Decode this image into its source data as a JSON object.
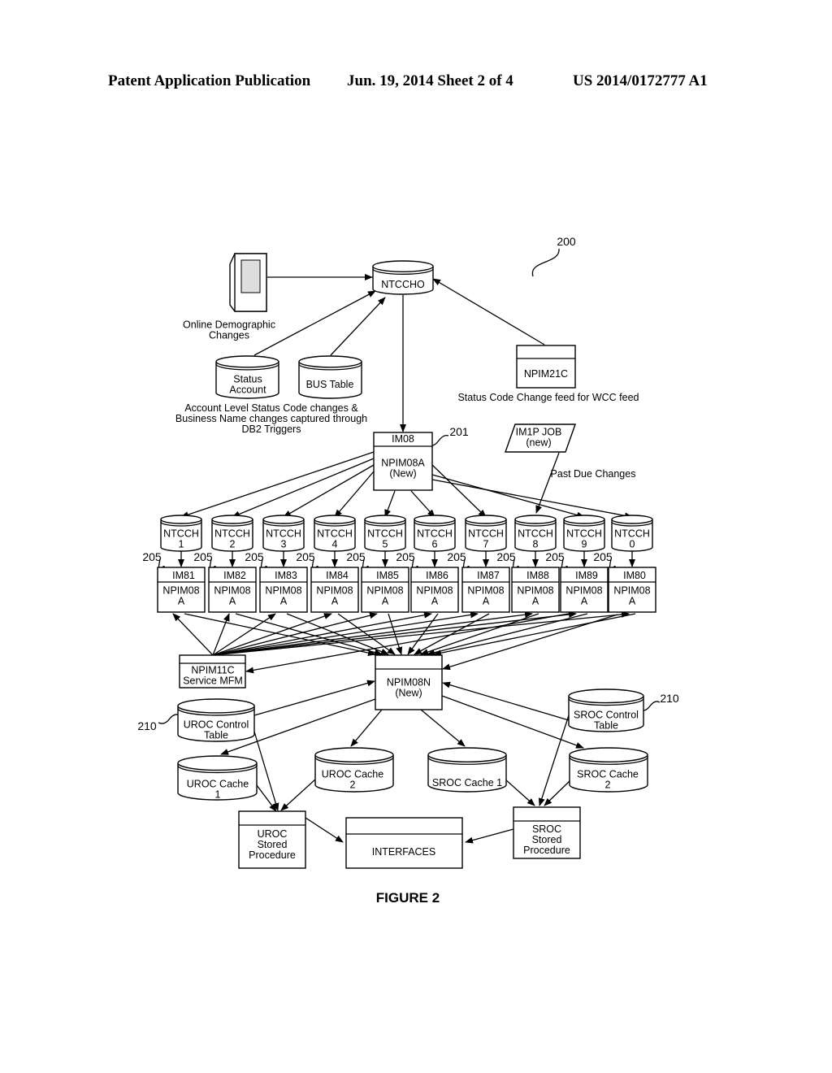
{
  "header": {
    "left": "Patent Application Publication",
    "center": "Jun. 19, 2014  Sheet 2 of 4",
    "right": "US 2014/0172777 A1"
  },
  "figure": {
    "caption": "FIGURE 2",
    "ref_main": "200",
    "ref_npim08a": "201",
    "ref_im": "205",
    "ref_control": "210"
  },
  "nodes": {
    "terminal_label": [
      "Online Demographic",
      "Changes"
    ],
    "ntccho": "NTCCHO",
    "status_account": [
      "Status",
      "Account"
    ],
    "bus_table": [
      "BUS Table"
    ],
    "db2_note": [
      "Account Level Status Code changes &",
      "Business Name changes captured through",
      "DB2 Triggers"
    ],
    "npim21c": "NPIM21C",
    "npim21c_note": "Status Code Change feed for WCC feed",
    "im08": "IM08",
    "npim08a": [
      "NPIM08A",
      "(New)"
    ],
    "im1p_job": [
      "IM1P JOB",
      "(new)"
    ],
    "past_due": "Past Due Changes",
    "npim11c": [
      "NPIM11C",
      "Service MFM"
    ],
    "npim08n": [
      "NPIM08N",
      "(New)"
    ],
    "uroc_control": [
      "UROC Control",
      "Table"
    ],
    "sroc_control": [
      "SROC Control",
      "Table"
    ],
    "uroc_cache1": [
      "UROC  Cache",
      "1"
    ],
    "uroc_cache2": [
      "UROC  Cache",
      "2"
    ],
    "sroc_cache1": [
      "SROC Cache 1"
    ],
    "sroc_cache2": [
      "SROC  Cache",
      "2"
    ],
    "uroc_sp": [
      "UROC",
      "Stored",
      "Procedure"
    ],
    "interfaces": "INTERFACES",
    "sroc_sp": [
      "SROC",
      "Stored",
      "Procedure"
    ]
  },
  "partitions": [
    {
      "db": [
        "NTCCH",
        "1"
      ],
      "im": "IM81",
      "proc": [
        "NPIM08",
        "A"
      ]
    },
    {
      "db": [
        "NTCCH",
        "2"
      ],
      "im": "IM82",
      "proc": [
        "NPIM08",
        "A"
      ]
    },
    {
      "db": [
        "NTCCH",
        "3"
      ],
      "im": "IM83",
      "proc": [
        "NPIM08",
        "A"
      ]
    },
    {
      "db": [
        "NTCCH",
        "4"
      ],
      "im": "IM84",
      "proc": [
        "NPIM08",
        "A"
      ]
    },
    {
      "db": [
        "NTCCH",
        "5"
      ],
      "im": "IM85",
      "proc": [
        "NPIM08",
        "A"
      ]
    },
    {
      "db": [
        "NTCCH",
        "6"
      ],
      "im": "IM86",
      "proc": [
        "NPIM08",
        "A"
      ]
    },
    {
      "db": [
        "NTCCH",
        "7"
      ],
      "im": "IM87",
      "proc": [
        "NPIM08",
        "A"
      ]
    },
    {
      "db": [
        "NTCCH",
        "8"
      ],
      "im": "IM88",
      "proc": [
        "NPIM08",
        "A"
      ]
    },
    {
      "db": [
        "NTCCH",
        "9"
      ],
      "im": "IM89",
      "proc": [
        "NPIM08",
        "A"
      ]
    },
    {
      "db": [
        "NTCCH",
        "0"
      ],
      "im": "IM80",
      "proc": [
        "NPIM08",
        "A"
      ]
    }
  ]
}
